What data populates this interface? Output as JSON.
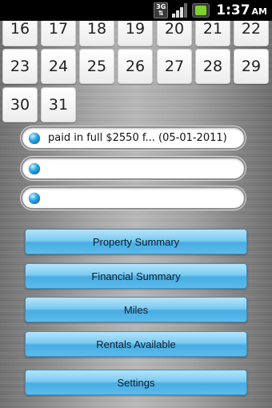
{
  "status_bar": {
    "network": "3G",
    "time": "1:37",
    "ampm": "AM"
  },
  "calendar": {
    "row1": [
      "16",
      "17",
      "18",
      "19",
      "20",
      "21",
      "22"
    ],
    "row2": [
      "23",
      "24",
      "25",
      "26",
      "27",
      "28",
      "29"
    ],
    "row3": [
      "30",
      "31"
    ]
  },
  "notes": [
    {
      "text": "paid in full $2550 f... (05-01-2011)"
    },
    {
      "text": ""
    },
    {
      "text": ""
    }
  ],
  "menu": {
    "property_summary": "Property Summary",
    "financial_summary": "Financial Summary",
    "miles": "Miles",
    "rentals_available": "Rentals Available",
    "settings": "Settings"
  }
}
